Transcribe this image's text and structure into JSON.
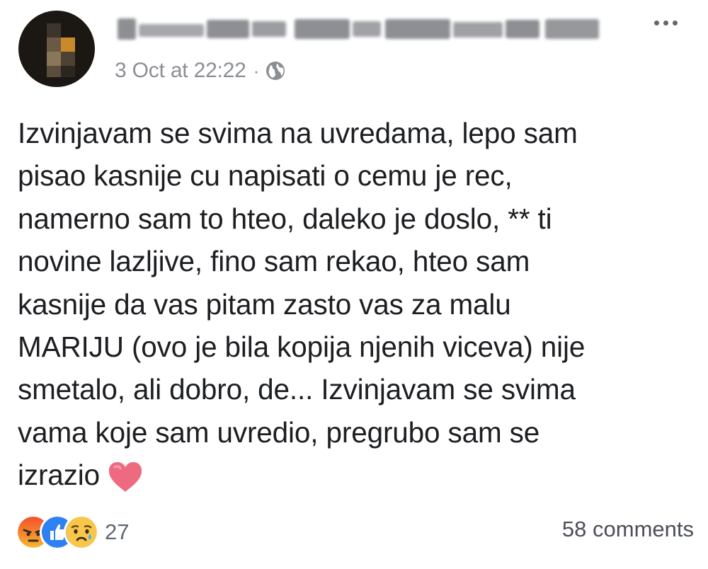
{
  "post": {
    "timestamp": "3 Oct at 22:22",
    "separator": "·",
    "privacy_icon": "globe-icon",
    "body_lines": [
      "Izvinjavam se svima na uvredama, lepo sam",
      "pisao kasnije cu napisati o cemu je rec,",
      "namerno sam to hteo, daleko je doslo, ** ti",
      "novine lazljive, fino sam rekao, hteo sam",
      "kasnije da vas pitam zasto vas za malu",
      "MARIJU (ovo je bila kopija njenih viceva) nije",
      "smetalo, ali dobro, de... Izvinjavam se svima",
      "vama koje sam uvredio, pregrubo sam se",
      "izrazio"
    ],
    "trailing_emoji": "heart-emoji"
  },
  "footer": {
    "reaction_icons": [
      "angry-reaction-icon",
      "like-reaction-icon",
      "sad-reaction-icon"
    ],
    "reaction_count": "27",
    "comments_label": "58 comments"
  },
  "colors": {
    "text": "#1c1e21",
    "meta": "#8b8e93",
    "like_blue": "#2e81f3",
    "angry_red": "#f2502c",
    "sad_yellow": "#f7c64b",
    "heart_pink": "#ee6a80"
  }
}
